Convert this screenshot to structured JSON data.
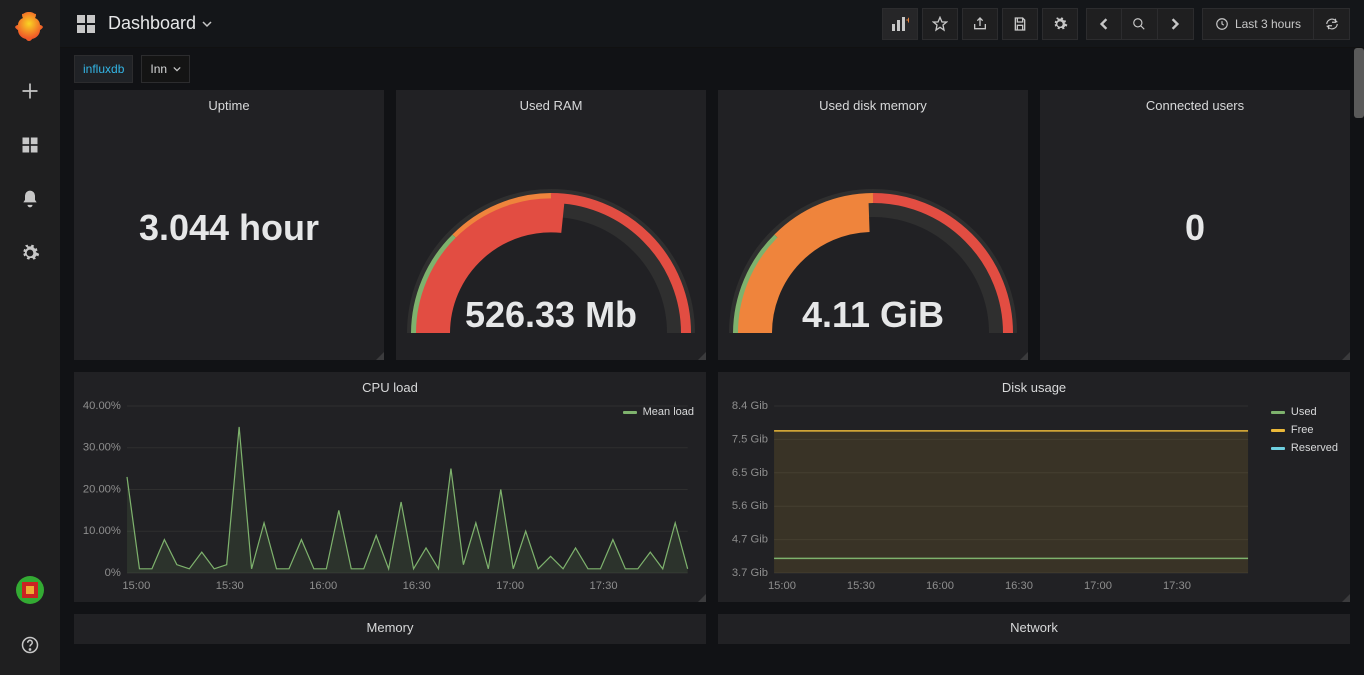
{
  "header": {
    "title": "Dashboard",
    "time_range_label": "Last 3 hours"
  },
  "variables": {
    "label": "influxdb",
    "selected": "Inn"
  },
  "panels": {
    "uptime": {
      "title": "Uptime",
      "value": "3.044 hour"
    },
    "used_ram": {
      "title": "Used RAM",
      "value": "526.33 Mb"
    },
    "used_disk": {
      "title": "Used disk memory",
      "value": "4.11 GiB"
    },
    "connected_users": {
      "title": "Connected users",
      "value": "0"
    },
    "cpu_load": {
      "title": "CPU load",
      "legend": "Mean load"
    },
    "disk_usage": {
      "title": "Disk usage",
      "legend_used": "Used",
      "legend_free": "Free",
      "legend_reserved": "Reserved"
    },
    "memory": {
      "title": "Memory"
    },
    "network": {
      "title": "Network"
    }
  },
  "chart_data": [
    {
      "type": "line",
      "title": "CPU load",
      "xlabel": "",
      "ylabel": "",
      "ylim": [
        0,
        40
      ],
      "y_unit": "%",
      "x_ticks": [
        "15:00",
        "15:30",
        "16:00",
        "16:30",
        "17:00",
        "17:30"
      ],
      "y_ticks": [
        "0%",
        "10.00%",
        "20.00%",
        "30.00%",
        "40.00%"
      ],
      "series": [
        {
          "name": "Mean load",
          "color": "#7eb26d",
          "x": [
            "14:50",
            "14:52",
            "14:55",
            "14:58",
            "15:00",
            "15:05",
            "15:10",
            "15:15",
            "15:20",
            "15:22",
            "15:25",
            "15:28",
            "15:30",
            "15:35",
            "15:38",
            "15:40",
            "15:45",
            "15:50",
            "15:55",
            "16:00",
            "16:03",
            "16:05",
            "16:08",
            "16:10",
            "16:13",
            "16:15",
            "16:18",
            "16:20",
            "16:25",
            "16:28",
            "16:30",
            "16:33",
            "16:35",
            "16:40",
            "16:45",
            "16:48",
            "16:50",
            "16:55",
            "17:00",
            "17:05",
            "17:10",
            "17:20",
            "17:25",
            "17:30",
            "17:35",
            "17:40"
          ],
          "values": [
            23,
            1,
            1,
            8,
            2,
            1,
            5,
            1,
            2,
            35,
            1,
            12,
            1,
            1,
            8,
            1,
            1,
            15,
            1,
            1,
            9,
            1,
            17,
            1,
            6,
            1,
            25,
            2,
            12,
            1,
            20,
            1,
            10,
            1,
            4,
            1,
            6,
            1,
            1,
            8,
            1,
            1,
            5,
            1,
            12,
            1
          ]
        }
      ]
    },
    {
      "type": "area",
      "title": "Disk usage",
      "xlabel": "",
      "ylabel": "",
      "ylim": [
        3.7,
        8.4
      ],
      "y_unit": "Gib",
      "x_ticks": [
        "15:00",
        "15:30",
        "16:00",
        "16:30",
        "17:00",
        "17:30"
      ],
      "y_ticks": [
        "3.7 Gib",
        "4.7 Gib",
        "5.6 Gib",
        "6.5 Gib",
        "7.5 Gib",
        "8.4 Gib"
      ],
      "series": [
        {
          "name": "Used",
          "color": "#7eb26d",
          "constant_value": 4.11
        },
        {
          "name": "Free",
          "color": "#eab839",
          "constant_value": 7.7
        },
        {
          "name": "Reserved",
          "color": "#6ed0e0",
          "constant_value": 7.7
        }
      ]
    }
  ],
  "gauges": {
    "used_ram": {
      "fraction": 0.53,
      "colors": [
        "#7eb26d",
        "#ef843c",
        "#e24d42"
      ],
      "pointer_band": "#e24d42"
    },
    "used_disk": {
      "fraction": 0.49,
      "colors": [
        "#7eb26d",
        "#ef843c",
        "#e24d42"
      ],
      "pointer_band": "#ef843c"
    }
  }
}
